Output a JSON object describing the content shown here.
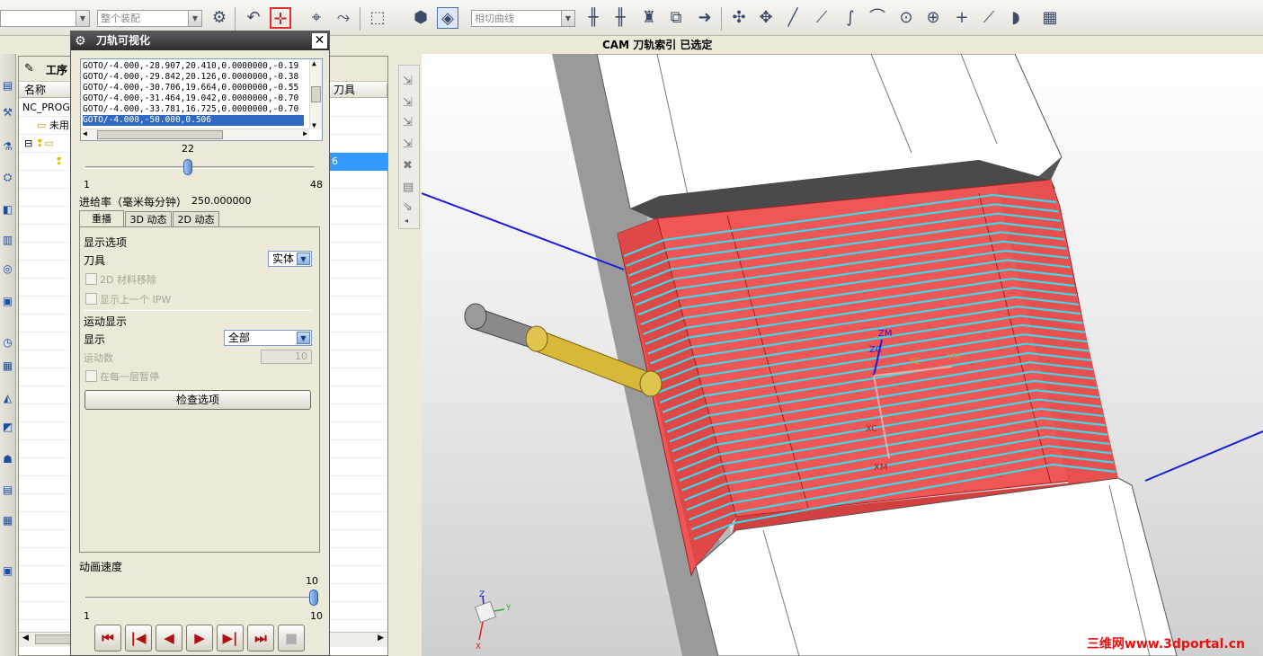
{
  "toolbar": {
    "combo1": "",
    "combo2": "整个装配",
    "combo3": "相切曲线",
    "icons": [
      "assembly-filter-icon",
      "undo-icon",
      "select-filter-icon",
      "snap-point-icon",
      "move-icon",
      "rectangle-select-icon",
      "shaded-solid-icon",
      "view-cube-icon",
      "dimension-icon",
      "dimension-2-icon",
      "manufacture-icon",
      "workpiece-icon",
      "arrow-icon",
      "point-set-icon",
      "point-constructor-icon",
      "line-icon",
      "polyline-icon",
      "curve-icon",
      "arc-icon",
      "circle-icon",
      "ellipse-icon",
      "cross-icon",
      "endpoint-icon",
      "helix-icon",
      "table-icon"
    ]
  },
  "cam_status": "CAM  刀轨索引  已选定",
  "nav": {
    "header": "工序",
    "columns": [
      "名称",
      "刀具"
    ],
    "rows": [
      "NC_PROGRAM",
      "未用",
      "",
      ""
    ],
    "selected_value": "6"
  },
  "dialog": {
    "title": "刀轨可视化",
    "close": "✕",
    "listbox_lines": [
      "GOTO/-4.000,-28.907,20.410,0.0000000,-0.19",
      "GOTO/-4.000,-29.842,20.126,0.0000000,-0.38",
      "GOTO/-4.000,-30.706,19.664,0.0000000,-0.55",
      "GOTO/-4.000,-31.464,19.042,0.0000000,-0.70",
      "GOTO/-4.000,-33.781,16.725,0.0000000,-0.70",
      "GOTO/-4.000,-50.000,0.506"
    ],
    "slider1": {
      "value": "22",
      "min": "1",
      "max": "48",
      "fraction": 0.447
    },
    "feedrate_label": "进给率（毫米每分钟）",
    "feedrate_value": "250.000000",
    "tabs": [
      "重播",
      "3D 动态",
      "2D 动态"
    ],
    "display_options_label": "显示选项",
    "tool_label": "刀具",
    "tool_value": "实体",
    "cb_2d_material": "2D 材料移除",
    "cb_prev_ipw": "显示上一个 IPW",
    "motion_display_label": "运动显示",
    "display_label": "显示",
    "display_value": "全部",
    "motion_count_label": "运动数",
    "motion_count_value": "10",
    "cb_pause_layer": "在每一层暂停",
    "check_options_button": "检查选项",
    "anim_speed_label": "动画速度",
    "speed_slider": {
      "value": "10",
      "min": "1",
      "max": "10",
      "fraction": 1.0
    },
    "playback": [
      "⏮",
      "|◀",
      "◀",
      "▶",
      "▶|",
      "⏭",
      "■"
    ]
  },
  "viewport": {
    "wcs": {
      "zm": "ZM",
      "zc": "ZC",
      "yc": "YC",
      "ym": "YM",
      "xc": "XC",
      "xm": "XM"
    },
    "triad": {
      "z": "Z",
      "y": "Y",
      "x": "X"
    }
  },
  "watermark": "三维网www.3dportal.cn",
  "colors": {
    "part_red": "#f05656",
    "toolpath_cyan": "#40d8e8",
    "tool_yellow": "#d8b838",
    "axis_blue": "#1c1cd8"
  }
}
